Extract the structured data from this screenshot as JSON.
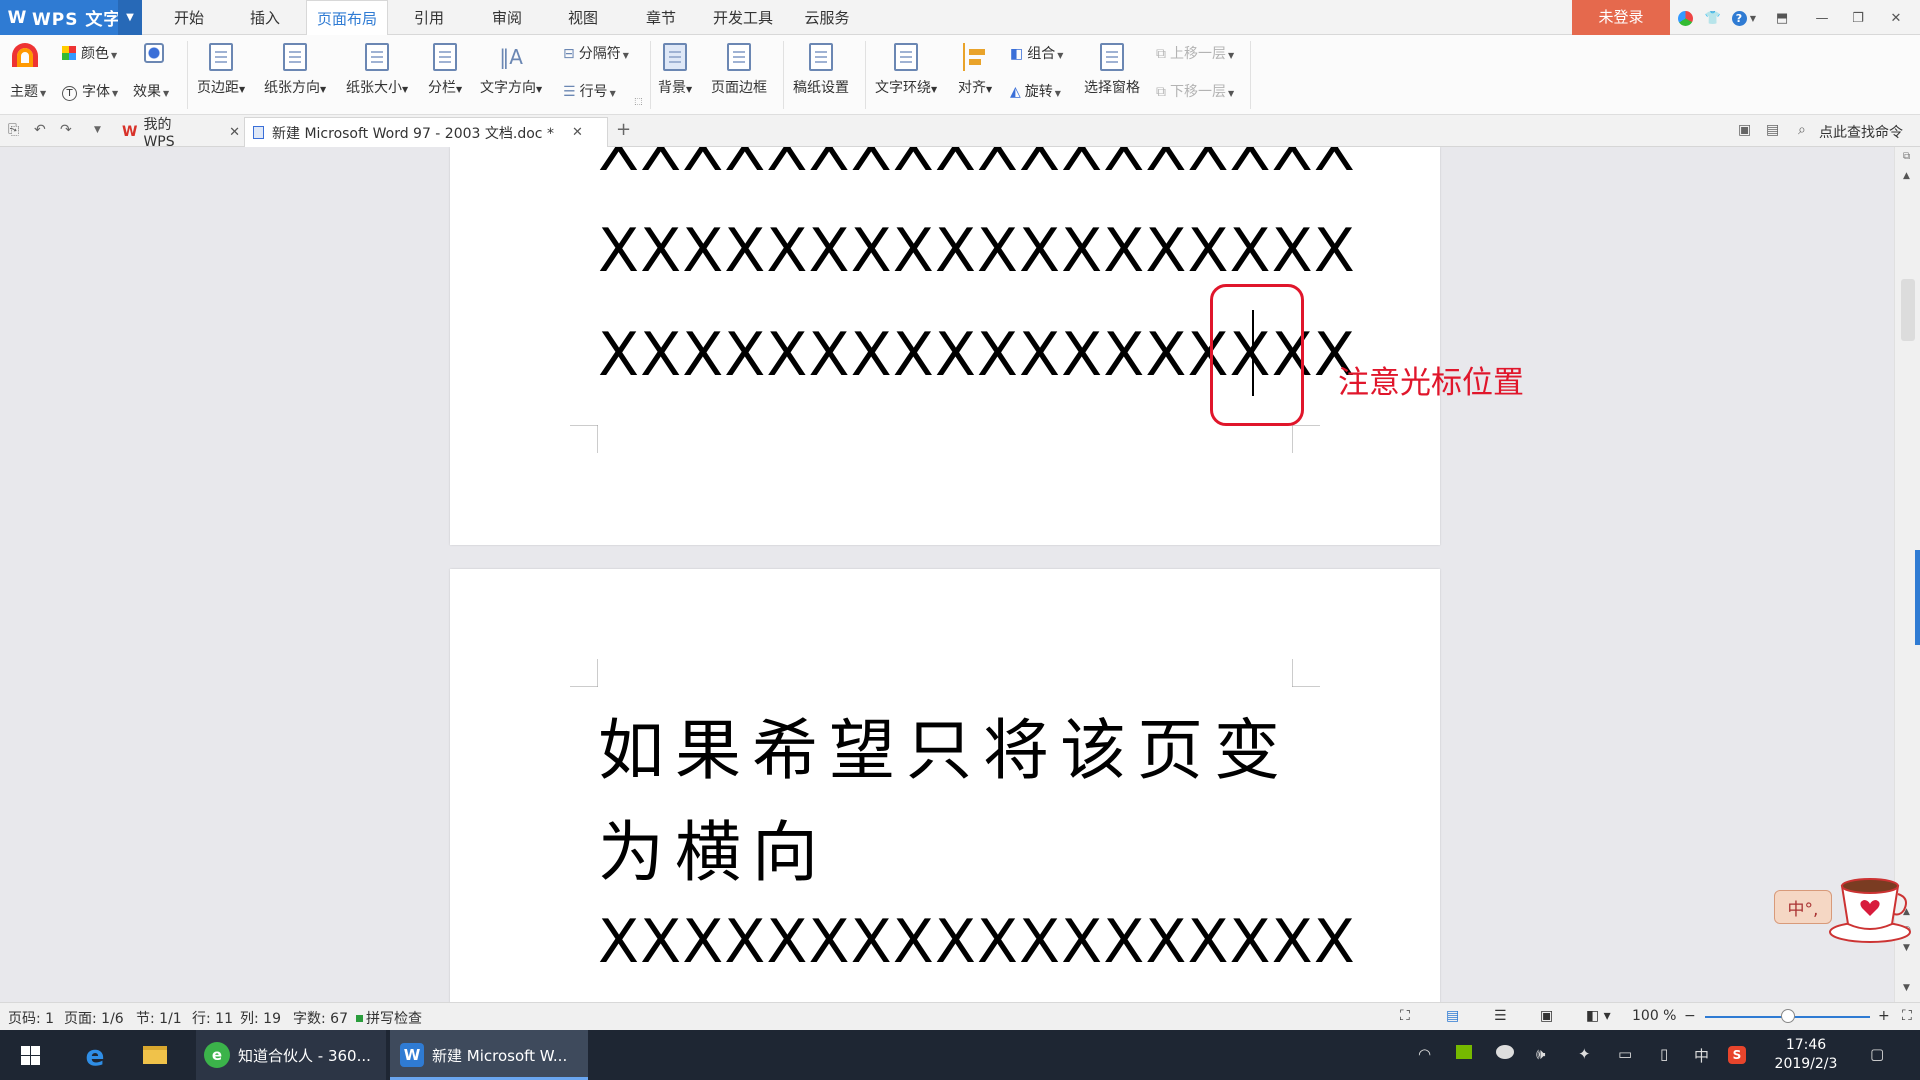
{
  "app": {
    "name": "WPS 文字",
    "logo": "W"
  },
  "menu": {
    "tabs": [
      "开始",
      "插入",
      "页面布局",
      "引用",
      "审阅",
      "视图",
      "章节",
      "开发工具",
      "云服务"
    ],
    "active_tab": "页面布局",
    "login_label": "未登录"
  },
  "ribbon": {
    "theme": "主题",
    "colors": "颜色",
    "fonts": "字体",
    "effects": "效果",
    "margins": "页边距",
    "orientation": "纸张方向",
    "size": "纸张大小",
    "columns": "分栏",
    "text_direction": "文字方向",
    "breaks": "分隔符",
    "line_numbers": "行号",
    "background": "背景",
    "page_border": "页面边框",
    "draft_settings": "稿纸设置",
    "text_wrap": "文字环绕",
    "align": "对齐",
    "group": "组合",
    "rotate": "旋转",
    "selection_pane": "选择窗格",
    "bring_forward": "上移一层",
    "send_backward": "下移一层"
  },
  "doc_tabs": {
    "home_tab": "我的WPS",
    "active_tab": "新建 Microsoft Word 97 - 2003 文档.doc *",
    "search_command": "点此查找命令"
  },
  "document": {
    "page1_lines": [
      "XXXXXXXXXXXXXXXXXX",
      "XXXXXXXXXXXXXXXXXX",
      "XXXXXXXXXXXXXXXXXX"
    ],
    "page2_cn_lines": [
      "如果希望只将该页变",
      "为横向"
    ],
    "page2_x_line": "XXXXXXXXXXXXXXXXXX",
    "annotation": "注意光标位置",
    "annotation_color": "#e0162b"
  },
  "status": {
    "page_no": "页码: 1",
    "pages": "页面: 1/6",
    "section": "节: 1/1",
    "row": "行: 11",
    "col": "列: 19",
    "word_count": "字数: 67",
    "spell_check": "拼写检查",
    "zoom": "100 %",
    "zoom_minus": "−",
    "zoom_plus": "+",
    "zoom_level": 0.5
  },
  "taskbar": {
    "items": [
      "知道合伙人 - 360...",
      "新建 Microsoft W..."
    ],
    "ime": "中",
    "time": "17:46",
    "date": "2019/2/3"
  },
  "ime_widget": {
    "label": "中°,"
  },
  "colors": {
    "accent": "#2f7bd3",
    "login_bg": "#e5694d",
    "taskbar": "#1e2633"
  }
}
